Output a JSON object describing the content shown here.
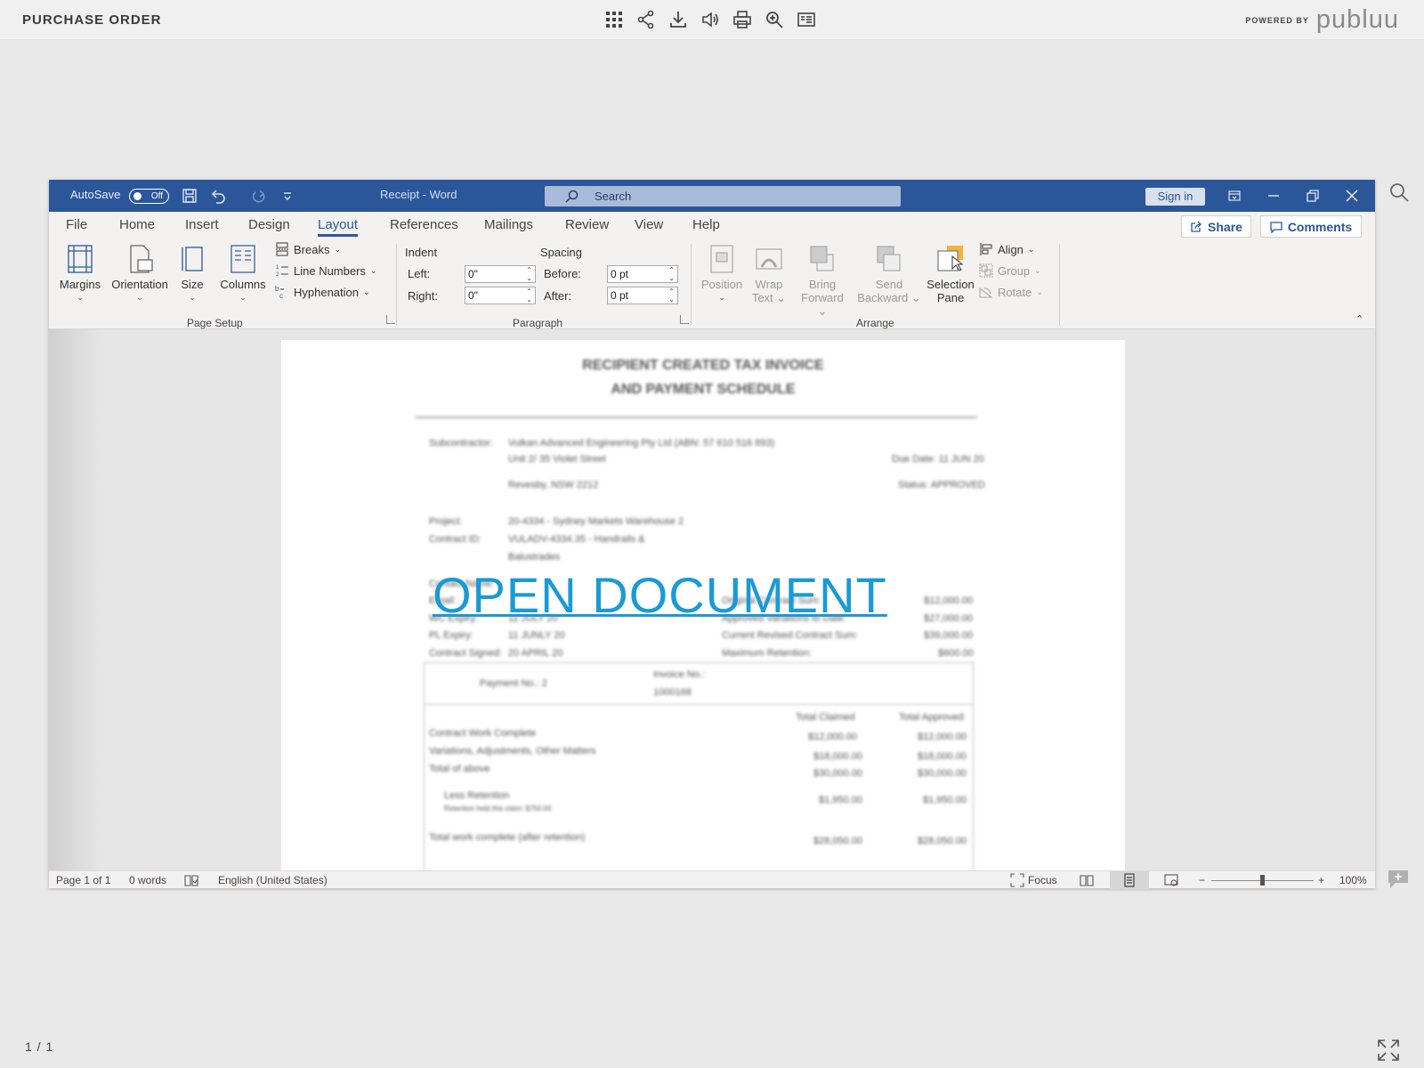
{
  "viewer": {
    "title": "PURCHASE ORDER",
    "powered_by": "POWERED BY",
    "brand": "publuu",
    "page_count": "1 / 1",
    "tools": [
      "grid-icon",
      "share-icon",
      "download-icon",
      "sound-icon",
      "print-icon",
      "zoom-icon",
      "toc-icon"
    ]
  },
  "word": {
    "autosave_label": "AutoSave",
    "autosave_state": "Off",
    "doc_name": "Receipt  -  Word",
    "search_placeholder": "Search",
    "sign_in": "Sign in",
    "tabs": [
      "File",
      "Home",
      "Insert",
      "Design",
      "Layout",
      "References",
      "Mailings",
      "Review",
      "View",
      "Help"
    ],
    "active_tab": "Layout",
    "share": "Share",
    "comments": "Comments",
    "ribbon": {
      "margins": "Margins",
      "orientation": "Orientation",
      "size": "Size",
      "columns": "Columns",
      "breaks": "Breaks",
      "line_numbers": "Line Numbers",
      "hyphenation": "Hyphenation",
      "page_setup": "Page Setup",
      "indent": "Indent",
      "spacing": "Spacing",
      "left_label": "Left:",
      "right_label": "Right:",
      "before_label": "Before:",
      "after_label": "After:",
      "left_value": "0\"",
      "right_value": "0\"",
      "before_value": "0 pt",
      "after_value": "0 pt",
      "paragraph": "Paragraph",
      "position": "Position",
      "wrap_text_1": "Wrap",
      "wrap_text_2": "Text",
      "bring_forward_1": "Bring",
      "bring_forward_2": "Forward",
      "send_backward_1": "Send",
      "send_backward_2": "Backward",
      "selection_pane_1": "Selection",
      "selection_pane_2": "Pane",
      "align": "Align",
      "group": "Group",
      "rotate": "Rotate",
      "arrange": "Arrange"
    },
    "status": {
      "page": "Page 1 of 1",
      "words": "0 words",
      "language": "English (United States)",
      "focus": "Focus",
      "zoom": "100%",
      "zoom_level_percent": 100
    }
  },
  "document": {
    "title_line1": "RECIPIENT CREATED TAX INVOICE",
    "title_line2": "AND PAYMENT SCHEDULE",
    "subcontractor_label": "Subcontractor:",
    "subcontractor": "Vulkan Advanced Engineering Pty Ltd (ABN: 57 610 516 893)",
    "address1": "Unit 2/ 35 Violet Street",
    "address2": "Revesby, NSW 2212",
    "due_date": "Due Date: 11 JUN 20",
    "status": "Status: APPROVED",
    "project_label": "Project:",
    "project": "20-4334 - Sydney Markets Warehouse 2",
    "contract_label": "Contract ID:",
    "contract": "VULADV-4334.35 - Handrails &",
    "contract2": "Balustrades",
    "contact_label": "Contact Name:",
    "email_label": "Email:",
    "wc_label": "WC Expiry:",
    "wc_value": "11 JULY 20",
    "pl_label": "PL Expiry:",
    "pl_value": "11 JUNLY 20",
    "signed_label": "Contract Signed:",
    "signed_value": "20 APRIL 20",
    "original_sum_label": "Original Contract Sum:",
    "original_sum": "$12,000.00",
    "variations_label": "Approved Variations to Date:",
    "variations": "$27,000.00",
    "revised_label": "Current Revised Contract Sum:",
    "revised": "$39,000.00",
    "retention_label": "Maximum Retention:",
    "retention": "$600.00",
    "payment_no": "Payment No.: 2",
    "invoice_no_label": "Invoice No.:",
    "invoice_no": "1000168",
    "col_claimed": "Total Claimed",
    "col_approved": "Total Approved",
    "rows": [
      {
        "label": "Contract Work Complete",
        "claimed": "$12,000.00",
        "approved": "$12,000.00"
      },
      {
        "label": "Variations, Adjustments, Other Matters",
        "claimed": "$18,000.00",
        "approved": "$18,000.00"
      },
      {
        "label": "Total of above",
        "claimed": "$30,000.00",
        "approved": "$30,000.00"
      },
      {
        "label": "Less Retention",
        "claimed": "$1,950.00",
        "approved": "$1,950.00"
      },
      {
        "label": "Total work complete (after retention)",
        "claimed": "$28,050.00",
        "approved": "$28,050.00"
      }
    ],
    "retention_note": "Retention held this claim: $750.00",
    "open_document": "OPEN DOCUMENT"
  }
}
